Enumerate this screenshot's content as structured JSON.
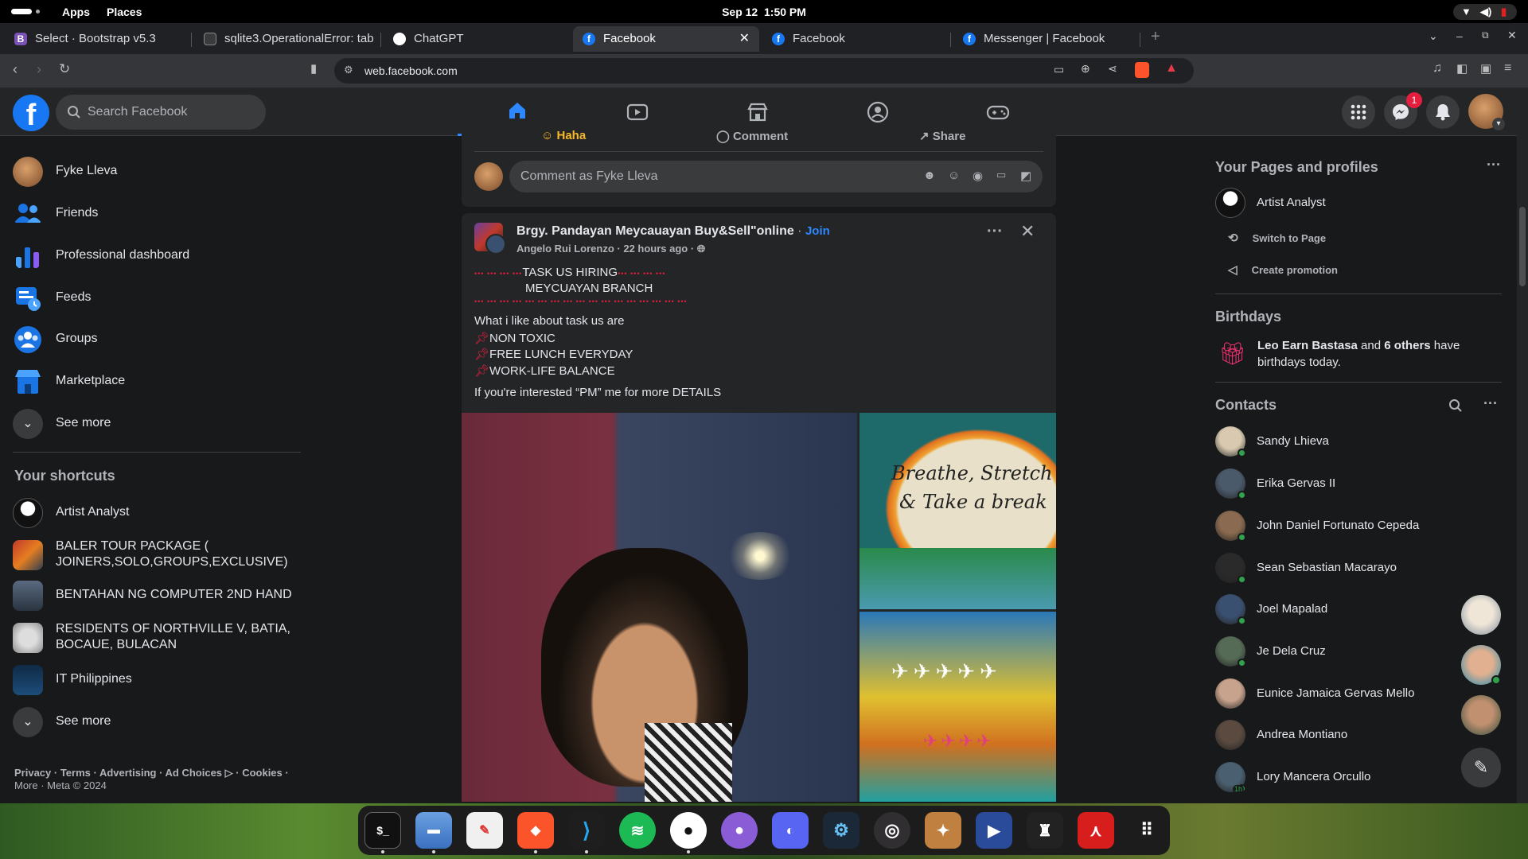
{
  "system": {
    "apps_label": "Apps",
    "places_label": "Places",
    "date": "Sep 12",
    "time": "1:50 PM"
  },
  "browser": {
    "tabs": [
      {
        "label": "Select · Bootstrap v5.3",
        "favicon": "bootstrap-icon",
        "color": "#7952b3"
      },
      {
        "label": "sqlite3.OperationalError: tab",
        "favicon": "terminal-icon",
        "color": "#3a3b3c"
      },
      {
        "label": "ChatGPT",
        "favicon": "chatgpt-icon",
        "color": "#ffffff"
      },
      {
        "label": "Facebook",
        "favicon": "facebook-icon",
        "color": "#1877f2",
        "active": true
      },
      {
        "label": "Facebook",
        "favicon": "facebook-icon",
        "color": "#1877f2"
      },
      {
        "label": "Messenger | Facebook",
        "favicon": "facebook-icon",
        "color": "#1877f2"
      }
    ],
    "new_tab": "+",
    "url": "web.facebook.com"
  },
  "facebook": {
    "search_placeholder": "Search Facebook",
    "notifications_badge": "1",
    "sidebar": {
      "items": [
        {
          "label": "Fyke Lleva",
          "icon": "profile-avatar"
        },
        {
          "label": "Friends",
          "icon": "friends-icon"
        },
        {
          "label": "Professional dashboard",
          "icon": "dashboard-icon"
        },
        {
          "label": "Feeds",
          "icon": "feeds-icon"
        },
        {
          "label": "Groups",
          "icon": "groups-icon"
        },
        {
          "label": "Marketplace",
          "icon": "marketplace-icon"
        }
      ],
      "see_more": "See more",
      "shortcuts_title": "Your shortcuts",
      "shortcuts": [
        {
          "label": "Artist Analyst"
        },
        {
          "label": "BALER TOUR PACKAGE ( JOINERS,SOLO,GROUPS,EXCLUSIVE)"
        },
        {
          "label": "BENTAHAN NG COMPUTER 2ND HAND"
        },
        {
          "label": "RESIDENTS OF NORTHVILLE V, BATIA, BOCAUE, BULACAN"
        },
        {
          "label": "IT Philippines"
        }
      ],
      "see_more_2": "See more",
      "footer_line1": "Privacy · Terms · Advertising · Ad Choices ▷ · Cookies ·",
      "footer_line2": "More · Meta © 2024"
    },
    "prev_post": {
      "action_haha": "Haha",
      "action_comment": "Comment",
      "action_share": "Share",
      "comment_placeholder": "Comment as Fyke Lleva"
    },
    "post": {
      "group": "Brgy. Pandayan Meycauayan Buy&Sell\"online",
      "join": "Join",
      "author": "Angelo Rui Lorenzo",
      "time": "22 hours ago",
      "dots_top": "•••  •••  •••  •••",
      "headline": "TASK US HIRING",
      "dots_after": "•••  •••  •••  •••",
      "branch": "MEYCUAYAN BRANCH",
      "dots_row": "•••  •••  •••  •••  •••  •••  •••  •••  •••  •••  •••  •••  •••  •••  •••  •••  •••",
      "line1": "What i like about task us are",
      "line2": "NON TOXIC",
      "line3": "FREE LUNCH EVERYDAY",
      "line4": "WORK-LIFE BALANCE",
      "line5": "If you're interested “PM” me for more DETAILS",
      "img_sign_line1": "Breathe, Stretch",
      "img_sign_line2": "& Take a break"
    },
    "right": {
      "pages_title": "Your Pages and profiles",
      "page_name": "Artist Analyst",
      "switch_label": "Switch to Page",
      "promo_label": "Create promotion",
      "birthdays_title": "Birthdays",
      "birthday_name": "Leo Earn Bastasa",
      "birthday_and": " and ",
      "birthday_others": "6 others",
      "birthday_rest": " have birthdays today.",
      "contacts_title": "Contacts",
      "contacts": [
        {
          "name": "Sandy Lhieva",
          "online": true,
          "color": "#d8c9b0"
        },
        {
          "name": "Erika Gervas II",
          "online": true,
          "color": "#4a5a6a"
        },
        {
          "name": "John Daniel Fortunato Cepeda",
          "online": true,
          "color": "#8a6a50"
        },
        {
          "name": "Sean Sebastian Macarayo",
          "online": true,
          "color": "#2a2a2a"
        },
        {
          "name": "Joel Mapalad",
          "online": true,
          "color": "#3a5070"
        },
        {
          "name": "Je Dela Cruz",
          "online": true,
          "color": "#556b55"
        },
        {
          "name": "Eunice Jamaica Gervas Mello",
          "online": false,
          "color": "#c7a28c"
        },
        {
          "name": "Andrea Montiano",
          "online": false,
          "color": "#5a4a40"
        },
        {
          "name": "Lory Mancera Orcullo",
          "online": true,
          "color": "#4a6070"
        }
      ],
      "lory_badge": "1h"
    }
  }
}
